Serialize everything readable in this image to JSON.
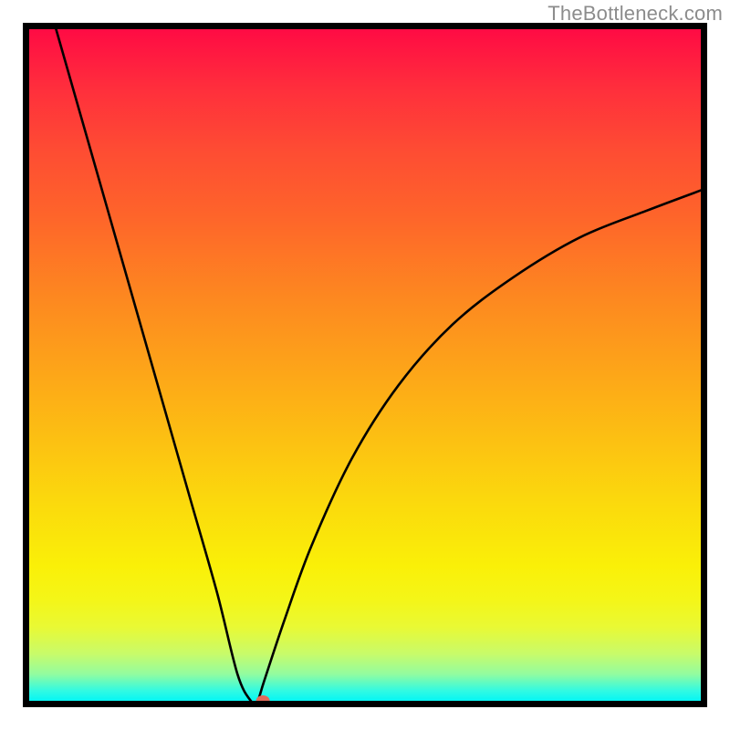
{
  "watermark": "TheBottleneck.com",
  "chart_data": {
    "type": "line",
    "title": "",
    "xlabel": "",
    "ylabel": "",
    "xlim": [
      0,
      100
    ],
    "ylim": [
      0,
      100
    ],
    "gradient_colormap": "red-to-turquoise (high=red=top, low=green/turquoise=bottom)",
    "curve_description": "Bottleneck V-curve: steep descent from top-left to a minimum near x≈33, then asymptotic rise toward the right",
    "minimum_point": {
      "x": 33,
      "y": 0
    },
    "marker": {
      "x": 34.8,
      "y": 0,
      "color": "#e26a5a",
      "shape": "ellipse"
    },
    "series": [
      {
        "name": "bottleneck-curve",
        "x": [
          4,
          8,
          12,
          16,
          20,
          24,
          28,
          31,
          33,
          34,
          35,
          38,
          42,
          48,
          55,
          63,
          72,
          82,
          92,
          100
        ],
        "y": [
          100,
          86,
          72,
          58,
          44,
          30,
          16,
          4,
          0,
          0,
          3,
          12,
          23,
          36,
          47,
          56,
          63,
          69,
          73,
          76
        ]
      }
    ]
  }
}
